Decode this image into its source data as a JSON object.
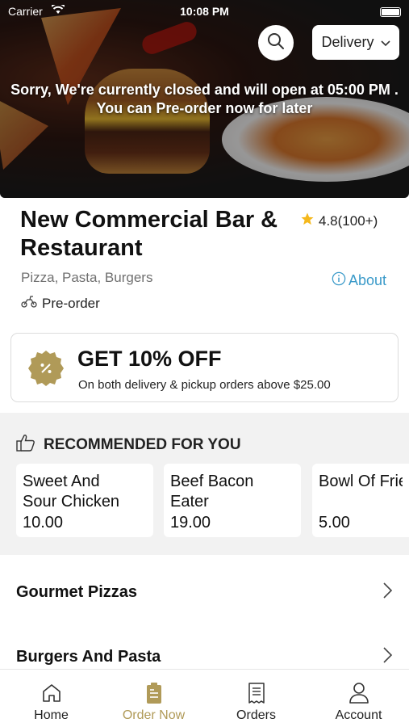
{
  "status_bar": {
    "carrier": "Carrier",
    "time": "10:08 PM"
  },
  "header": {
    "delivery_label": "Delivery",
    "closed_message_line1": "Sorry, We're currently closed and will open at 05:00 PM .",
    "closed_message_line2": "You can Pre-order now for later"
  },
  "restaurant": {
    "name": "New Commercial Bar & Restaurant",
    "rating": "4.8(100+)",
    "cuisines": "Pizza, Pasta, Burgers",
    "about_label": "About",
    "order_mode": "Pre-order"
  },
  "offer": {
    "title": "GET 10% OFF",
    "subtitle": "On both delivery & pickup orders above $25.00"
  },
  "recommended": {
    "heading": "RECOMMENDED FOR YOU",
    "items": [
      {
        "name_line1": "Sweet And",
        "name_line2": "Sour Chicken",
        "price": "10.00"
      },
      {
        "name_line1": "Beef Bacon",
        "name_line2": "Eater",
        "price": "19.00"
      },
      {
        "name_line1": "Bowl Of Fries",
        "name_line2": "",
        "price": "5.00"
      }
    ]
  },
  "categories": [
    {
      "label": "Gourmet Pizzas"
    },
    {
      "label": "Burgers And Pasta"
    }
  ],
  "tabbar": {
    "items": [
      {
        "label": "Home",
        "icon": "home-icon",
        "active": false
      },
      {
        "label": "Order Now",
        "icon": "order-bag-icon",
        "active": true
      },
      {
        "label": "Orders",
        "icon": "receipt-icon",
        "active": false
      },
      {
        "label": "Account",
        "icon": "person-icon",
        "active": false
      }
    ]
  },
  "colors": {
    "accent": "#B09A58",
    "link": "#3A9AC9",
    "star": "#F5B81C"
  }
}
